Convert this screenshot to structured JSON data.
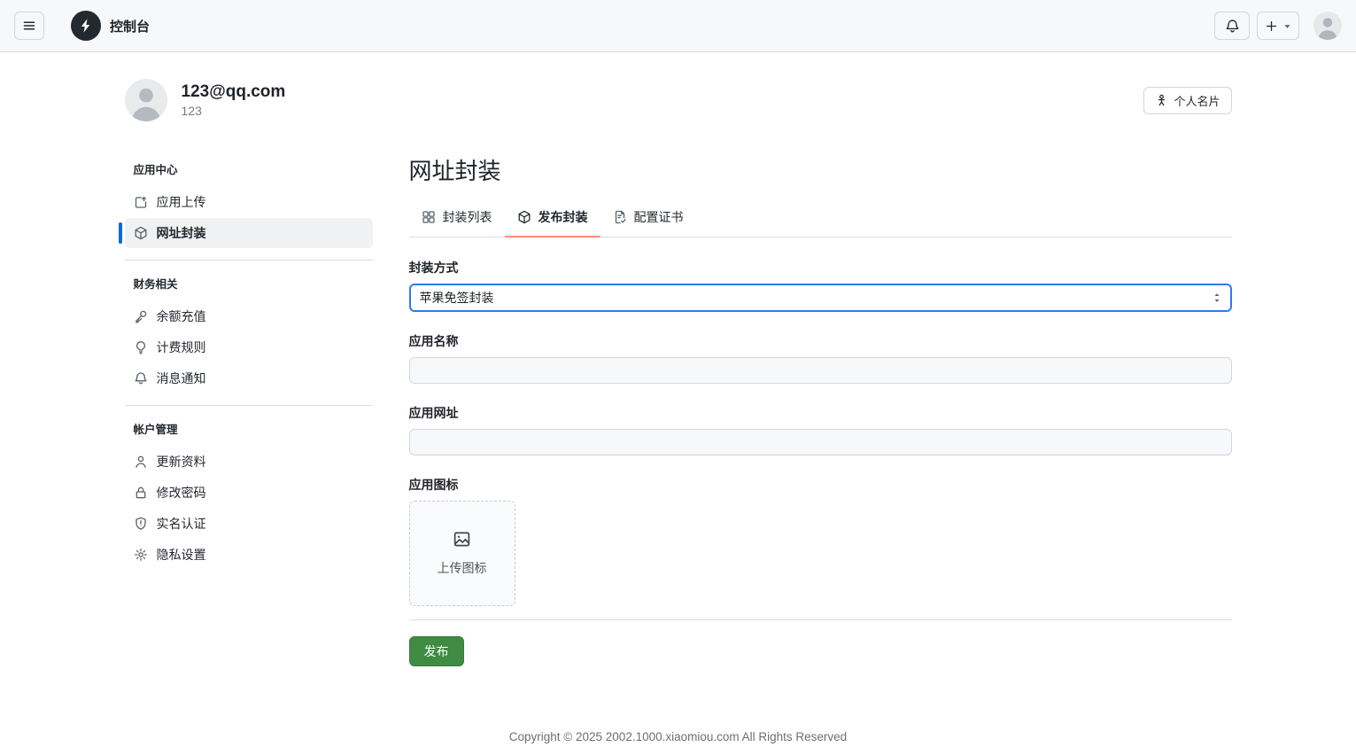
{
  "navbar": {
    "title": "控制台",
    "icons": {
      "menu": "hamburger-icon",
      "logo": "zap-logo",
      "bell": "bell-icon",
      "add": "plus-icon",
      "avatar": "user-avatar"
    }
  },
  "profile": {
    "email": "123@qq.com",
    "username": "123",
    "card_button_label": "个人名片"
  },
  "sidebar": {
    "sections": [
      {
        "title": "应用中心",
        "items": [
          {
            "label": "应用上传",
            "icon": "upload-box-icon",
            "active": false
          },
          {
            "label": "网址封装",
            "icon": "package-icon",
            "active": true
          }
        ]
      },
      {
        "title": "财务相关",
        "items": [
          {
            "label": "余额充值",
            "icon": "key-icon",
            "active": false
          },
          {
            "label": "计费规则",
            "icon": "lightbulb-icon",
            "active": false
          },
          {
            "label": "消息通知",
            "icon": "bell-icon",
            "active": false
          }
        ]
      },
      {
        "title": "帐户管理",
        "items": [
          {
            "label": "更新资料",
            "icon": "person-icon",
            "active": false
          },
          {
            "label": "修改密码",
            "icon": "lock-icon",
            "active": false
          },
          {
            "label": "实名认证",
            "icon": "shield-icon",
            "active": false
          },
          {
            "label": "隐私设置",
            "icon": "gear-icon",
            "active": false
          }
        ]
      }
    ]
  },
  "main": {
    "title": "网址封装",
    "tabs": [
      {
        "label": "封装列表",
        "icon": "apps-icon",
        "active": false
      },
      {
        "label": "发布封装",
        "icon": "package-icon",
        "active": true
      },
      {
        "label": "配置证书",
        "icon": "file-check-icon",
        "active": false
      }
    ],
    "form": {
      "package_method": {
        "label": "封装方式",
        "value": "苹果免签封装"
      },
      "app_name": {
        "label": "应用名称",
        "value": ""
      },
      "app_url": {
        "label": "应用网址",
        "value": ""
      },
      "app_icon": {
        "label": "应用图标",
        "upload_text": "上传图标"
      },
      "submit_label": "发布"
    }
  },
  "footer": {
    "copyright": "Copyright © 2025 2002.1000.xiaomiou.com All Rights Reserved"
  },
  "colors": {
    "accent_blue": "#0969da",
    "tab_underline": "#fd8c73",
    "button_green": "#3f8b43",
    "navbar_bg": "#f6f8fa",
    "select_focus_border": "#2e7af0"
  }
}
